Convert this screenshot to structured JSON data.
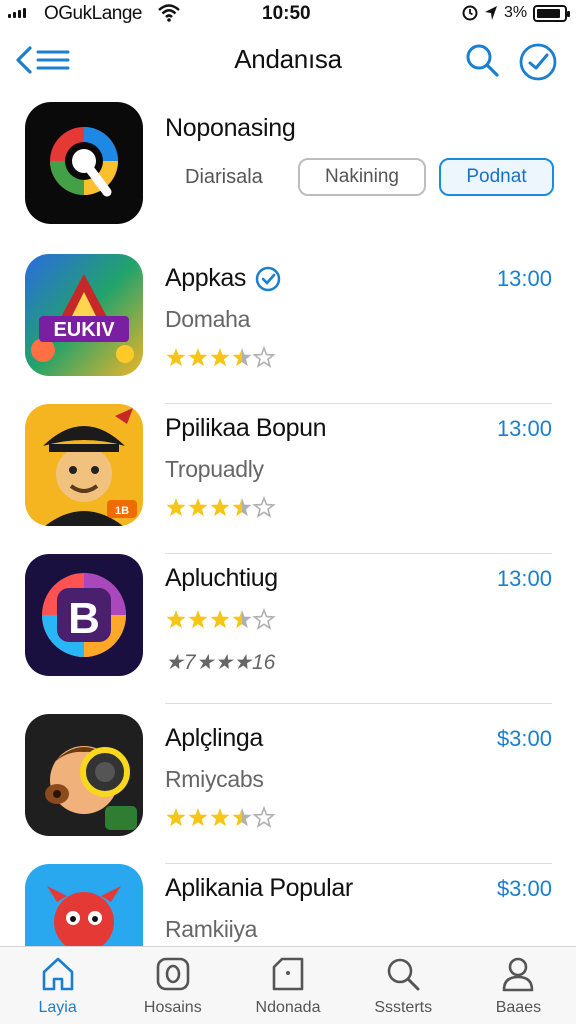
{
  "status_bar": {
    "carrier": "OGukLange",
    "time": "10:50",
    "battery_pct": "3%"
  },
  "nav": {
    "title": "Andanısa"
  },
  "featured": {
    "name": "Noponasing",
    "label": "Diarisala",
    "button_outline": "Nakining",
    "button_primary": "Podnat"
  },
  "apps": [
    {
      "name": "Appkas",
      "verified": true,
      "subtitle": "Domaha",
      "price": "13:00",
      "rating": 3.5
    },
    {
      "name": "Ppilikaa Bopun",
      "verified": false,
      "subtitle": "Tropuadly",
      "price": "13:00",
      "rating": 3.5
    },
    {
      "name": "Apluchtiug",
      "verified": false,
      "rating": 3.5,
      "rating_text": "★7★★★16",
      "price": "13:00"
    },
    {
      "name": "Aplçlinga",
      "verified": false,
      "subtitle": "Rmiycabs",
      "price": "$3:00",
      "rating": 3.5
    },
    {
      "name": "Aplikania Popular",
      "verified": false,
      "subtitle": "Ramkiiya",
      "price": "$3:00"
    }
  ],
  "icons": {
    "featured": "q-logo-icon",
    "apps": [
      "game-a-icon",
      "pirate-character-icon",
      "b-logo-icon",
      "headphone-character-icon",
      "red-creature-icon"
    ]
  },
  "tabs": [
    {
      "label": "Layia",
      "icon": "home-icon",
      "active": true
    },
    {
      "label": "Hosains",
      "icon": "o-square-icon",
      "active": false
    },
    {
      "label": "Ndonada",
      "icon": "box-icon",
      "active": false
    },
    {
      "label": "Sssterts",
      "icon": "search-icon",
      "active": false
    },
    {
      "label": "Baaes",
      "icon": "person-icon",
      "active": false
    }
  ],
  "colors": {
    "accent": "#1a7fd0",
    "star": "#f5c518",
    "star_empty": "#b0b0b0"
  }
}
